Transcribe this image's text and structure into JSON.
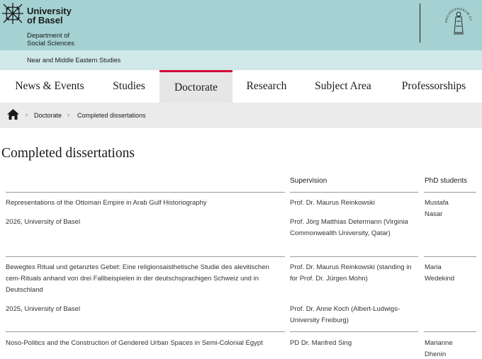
{
  "header": {
    "university_line1": "University",
    "university_line2": "of Basel",
    "department_line1": "Department of",
    "department_line2": "Social Sciences",
    "seal_inscription": "PHILOSOPHORUM ET HISTORICORUM ORDO"
  },
  "subbar": {
    "text": "Near and Middle Eastern Studies"
  },
  "nav": {
    "items": [
      {
        "label": "News & Events"
      },
      {
        "label": "Studies"
      },
      {
        "label": "Doctorate",
        "active": true
      },
      {
        "label": "Research"
      },
      {
        "label": "Subject Area"
      },
      {
        "label": "Professorships"
      }
    ]
  },
  "breadcrumb": {
    "items": [
      "Doctorate",
      "Completed dissertations"
    ]
  },
  "page": {
    "title": "Completed dissertations"
  },
  "table": {
    "headers": {
      "title": "",
      "supervision": "Supervision",
      "students": "PhD students"
    },
    "rows": [
      {
        "title": "Representations of the Ottoman Empire in Arab Gulf Historiography",
        "year": "2026, University of Basel",
        "supervision1": "Prof. Dr. Maurus Reinkowski",
        "supervision2": "Prof. Jörg Matthias Determann (Virginia Commonwealth University, Qatar)",
        "student": "Mustafa Nasar"
      },
      {
        "title": "Bewegtes Ritual und getanztes Gebet: Eine religionsaisthetische Studie des alevitischen cem-Rituals anhand von drei Fallbeispielen in der deutschsprachigen Schweiz und in Deutschland",
        "year": "2025, University of Basel",
        "supervision1": "Prof. Dr. Maurus Reinkowski (standing in for Prof. Dr. Jürgen Mohn)",
        "supervision2": "Prof. Dr. Anne Koch (Albert-Ludwigs-University Freiburg)",
        "student": "Maria Wedekind"
      },
      {
        "title": "Noso-Politics and the Construction of Gendered Urban Spaces in Semi-Colonial Egypt",
        "supervision1": "PD Dr. Manfred Sing",
        "student": "Marianne Dhenin"
      }
    ]
  },
  "colors": {
    "header_bg": "#a5d1d2",
    "subbar_bg": "#d1e8e8",
    "nav_active_accent": "#d20537",
    "breadcrumb_bg": "#ebebeb"
  },
  "icons": {
    "logo": "university-logo-icon",
    "seal": "seal-icon",
    "home": "home-icon",
    "separator": "chevron-right-icon"
  }
}
